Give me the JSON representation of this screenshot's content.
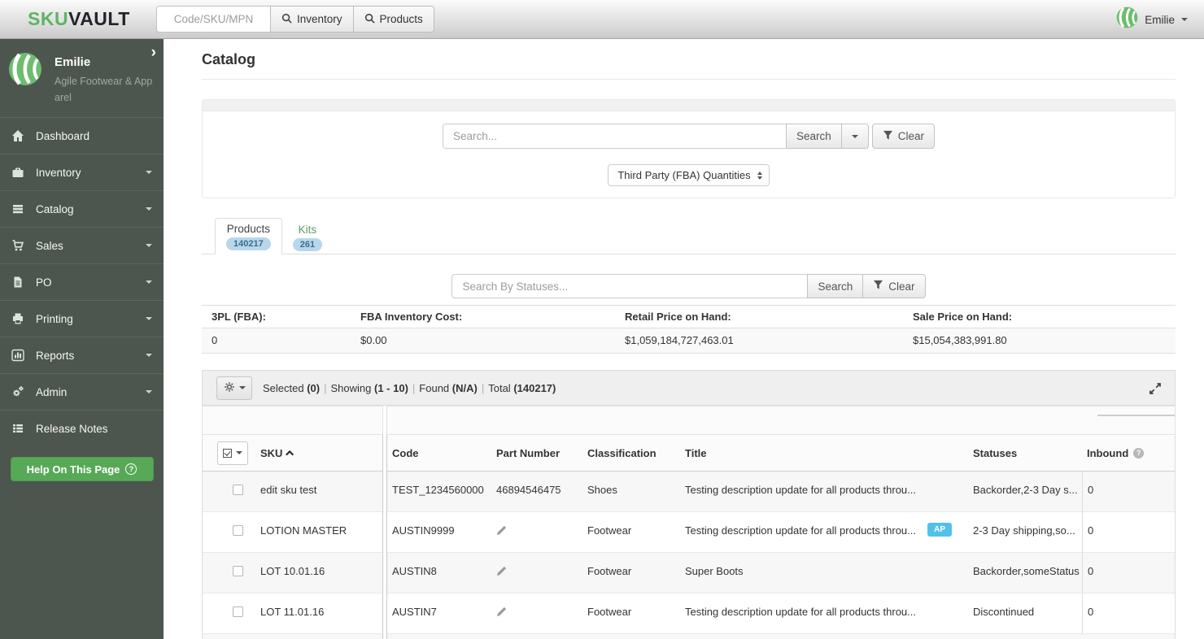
{
  "topbar": {
    "logo_sku": "SKU",
    "logo_vault": "VAULT",
    "search_placeholder": "Code/SKU/MPN",
    "inventory_button": {
      "label": "Inventory",
      "icon": "search-icon"
    },
    "products_button": {
      "label": "Products",
      "icon": "search-icon"
    },
    "user": {
      "name": "Emilie",
      "icon": "skuvault-ball-icon"
    }
  },
  "sidebar": {
    "collapse_chevron": "›",
    "profile": {
      "name": "Emilie",
      "company": "Agile Footwear & Apparel"
    },
    "items": [
      {
        "label": "Dashboard",
        "icon": "home-icon",
        "expandable": false
      },
      {
        "label": "Inventory",
        "icon": "briefcase-icon",
        "expandable": true
      },
      {
        "label": "Catalog",
        "icon": "catalog-list-icon",
        "expandable": true
      },
      {
        "label": "Sales",
        "icon": "cart-icon",
        "expandable": true
      },
      {
        "label": "PO",
        "icon": "document-icon",
        "expandable": true
      },
      {
        "label": "Printing",
        "icon": "printer-icon",
        "expandable": true
      },
      {
        "label": "Reports",
        "icon": "bar-chart-icon",
        "expandable": true
      },
      {
        "label": "Admin",
        "icon": "gears-icon",
        "expandable": true
      },
      {
        "label": "Release Notes",
        "icon": "list-icon",
        "expandable": false
      }
    ],
    "help_button": "Help On This Page"
  },
  "main": {
    "page_title": "Catalog",
    "search_panel": {
      "placeholder": "Search...",
      "search_button": "Search",
      "clear_button": "Clear",
      "quantity_select_value": "Third Party (FBA) Quantities"
    },
    "tabs": {
      "products": {
        "label": "Products",
        "count": "140217"
      },
      "kits": {
        "label": "Kits",
        "count": "261"
      }
    },
    "status_search": {
      "placeholder": "Search By Statuses...",
      "search_button": "Search",
      "clear_button": "Clear"
    },
    "stats": {
      "headers": [
        "3PL (FBA):",
        "FBA Inventory Cost:",
        "Retail Price on Hand:",
        "Sale Price on Hand:"
      ],
      "values": [
        "0",
        "$0.00",
        "$1,059,184,727,463.01",
        "$15,054,383,991.80"
      ]
    },
    "toolbar": {
      "selected_label": "Selected",
      "selected_value": "(0)",
      "showing_label": "Showing",
      "showing_value": "(1 - 10)",
      "found_label": "Found",
      "found_value": "(N/A)",
      "total_label": "Total",
      "total_value": "(140217)",
      "separator": "|"
    },
    "table": {
      "headers": {
        "sku": "SKU",
        "code": "Code",
        "part_number": "Part Number",
        "classification": "Classification",
        "title": "Title",
        "statuses": "Statuses",
        "inbound": "Inbound"
      },
      "rows": [
        {
          "sku": "edit sku test",
          "code": "TEST_1234560000",
          "part_number": "46894546475",
          "classification": "Shoes",
          "title": "Testing description update for all products throu...",
          "statuses": "Backorder,2-3 Day s...",
          "inbound": "0"
        },
        {
          "sku": "LOTION MASTER",
          "code": "AUSTIN9999",
          "classification": "Footwear",
          "title": "Testing description update for all products throu...",
          "badge": "AP",
          "statuses": "2-3 Day shipping,so...",
          "inbound": "0"
        },
        {
          "sku": "LOT 10.01.16",
          "code": "AUSTIN8",
          "classification": "Footwear",
          "title": "Super Boots",
          "statuses": "Backorder,someStatus",
          "inbound": "0"
        },
        {
          "sku": "LOT 11.01.16",
          "code": "AUSTIN7",
          "classification": "Footwear",
          "title": "Testing description update for all products throu...",
          "statuses": "Discontinued",
          "inbound": "0"
        }
      ]
    }
  },
  "colors": {
    "brand_green": "#5fb364",
    "sidebar_bg": "#4d564e",
    "help_button_green": "#57a957",
    "tab_count_badge_bg": "#b9d7ea",
    "tab_count_badge_text": "#396e90",
    "ap_badge_bg": "#52c1e9",
    "kits_tab_text": "#5f9a62"
  }
}
